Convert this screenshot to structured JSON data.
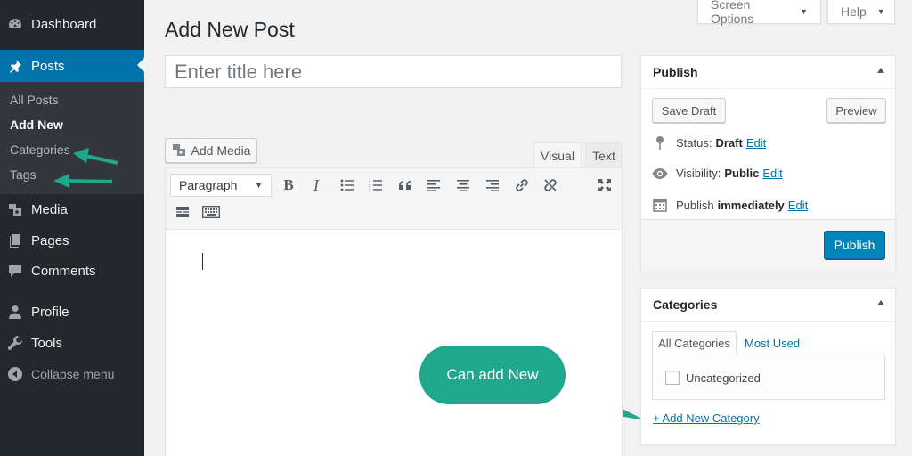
{
  "sidebar": {
    "items": [
      {
        "label": "Dashboard",
        "icon": "dashboard-icon"
      },
      {
        "label": "Posts",
        "icon": "pin-icon"
      },
      {
        "label": "Media",
        "icon": "media-icon"
      },
      {
        "label": "Pages",
        "icon": "pages-icon"
      },
      {
        "label": "Comments",
        "icon": "comments-icon"
      },
      {
        "label": "Profile",
        "icon": "profile-icon"
      },
      {
        "label": "Tools",
        "icon": "tools-icon"
      },
      {
        "label": "Collapse menu",
        "icon": "collapse-icon"
      }
    ],
    "submenu": [
      "All Posts",
      "Add New",
      "Categories",
      "Tags"
    ]
  },
  "header": {
    "screen_options": "Screen Options",
    "help": "Help",
    "title": "Add New Post"
  },
  "editor": {
    "title_placeholder": "Enter title here",
    "add_media": "Add Media",
    "tab_visual": "Visual",
    "tab_text": "Text",
    "format": "Paragraph"
  },
  "publish": {
    "heading": "Publish",
    "save_draft": "Save Draft",
    "preview": "Preview",
    "status_label": "Status:",
    "status_value": "Draft",
    "visibility_label": "Visibility:",
    "visibility_value": "Public",
    "publish_label": "Publish",
    "publish_value": "immediately",
    "edit": "Edit",
    "publish_button": "Publish"
  },
  "categories": {
    "heading": "Categories",
    "tab_all": "All Categories",
    "tab_most": "Most Used",
    "items": [
      "Uncategorized"
    ],
    "add_new": "+ Add New Category"
  },
  "annotation": {
    "callout": "Can add New",
    "color": "#1fa88b"
  },
  "colors": {
    "sidebar_bg": "#23282d",
    "accent": "#0073aa",
    "primary_button": "#0085ba"
  }
}
